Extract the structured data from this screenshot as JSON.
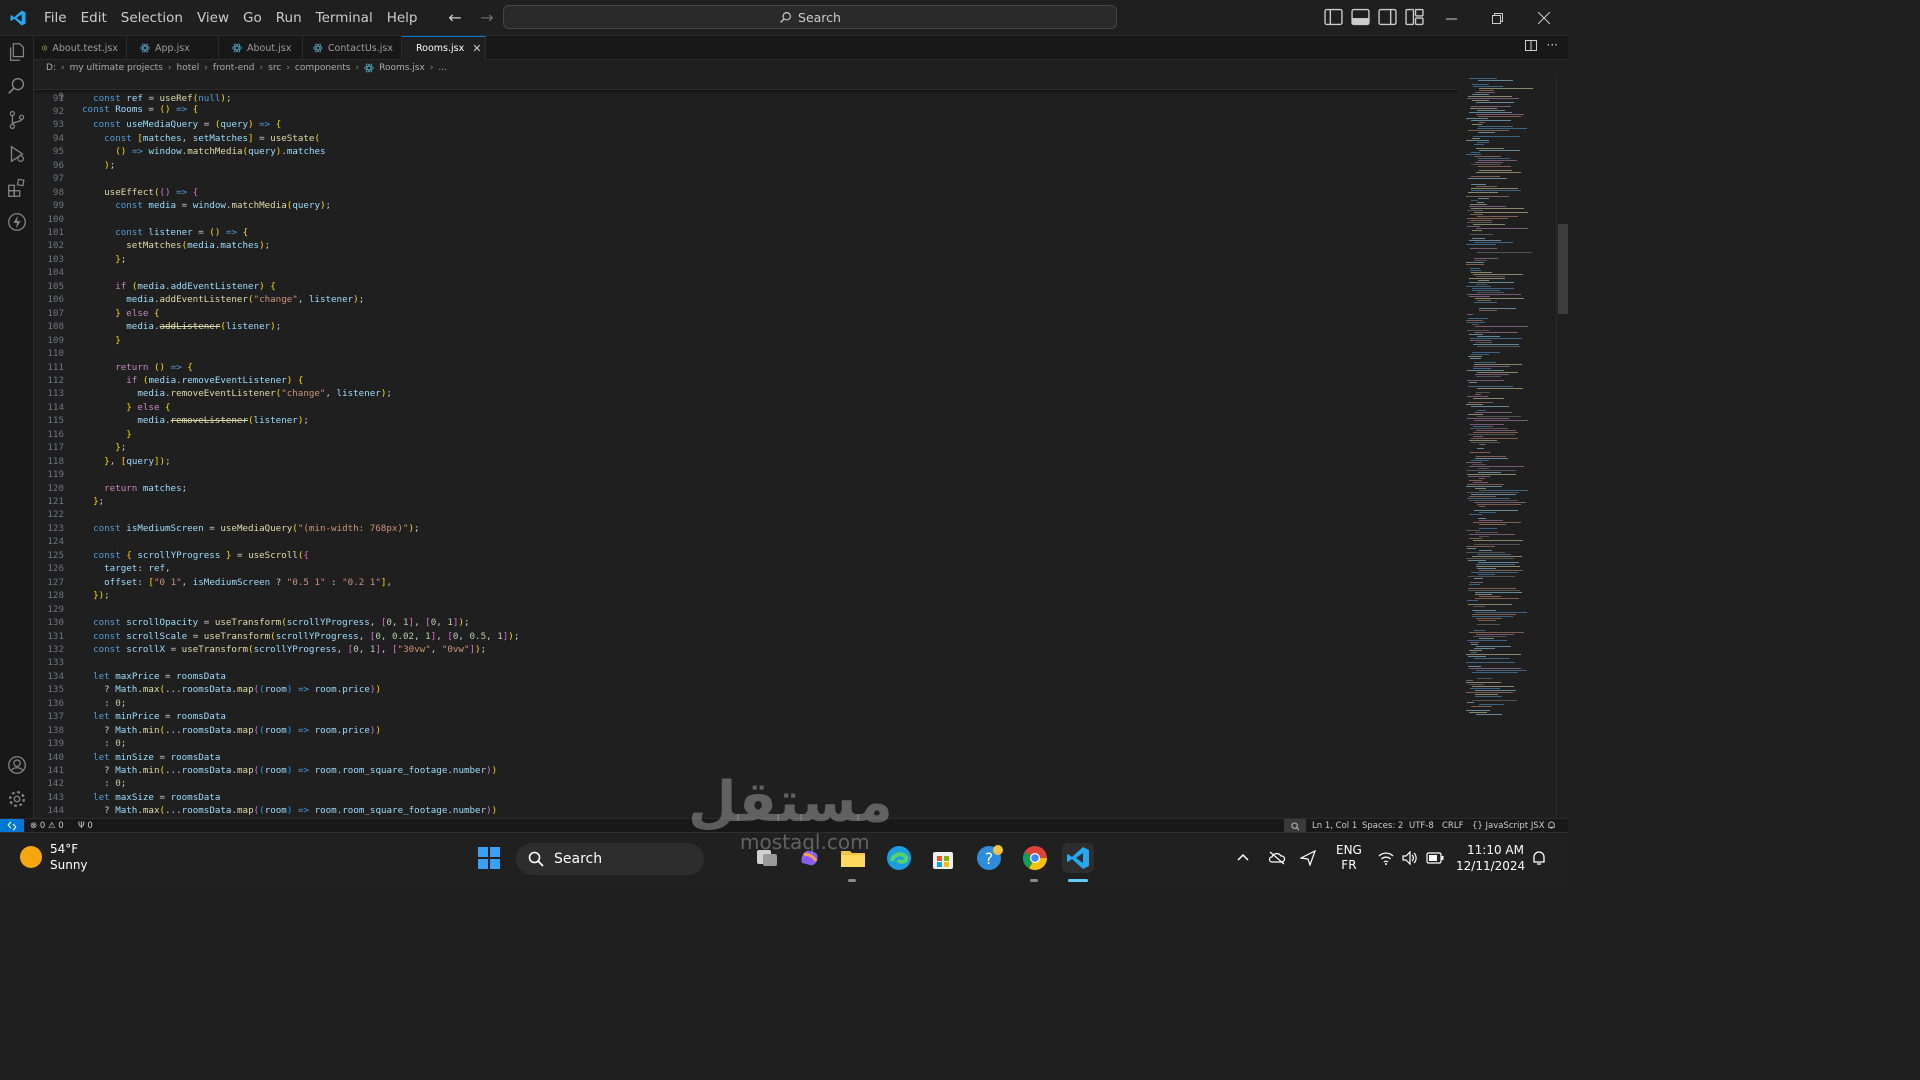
{
  "titlebar": {
    "menu": [
      "File",
      "Edit",
      "Selection",
      "View",
      "Go",
      "Run",
      "Terminal",
      "Help"
    ],
    "search_placeholder": "Search"
  },
  "tabs": [
    {
      "label": "About.test.jsx",
      "icon": "warning-react-icon",
      "active": false
    },
    {
      "label": "App.jsx",
      "icon": "react-icon",
      "active": false
    },
    {
      "label": "About.jsx",
      "icon": "react-icon",
      "active": false
    },
    {
      "label": "ContactUs.jsx",
      "icon": "react-icon",
      "active": false
    },
    {
      "label": "Rooms.jsx",
      "icon": "react-icon",
      "active": true
    }
  ],
  "breadcrumb": [
    "D:",
    "my ultimate projects",
    "hotel",
    "front-end",
    "src",
    "components",
    "Rooms.jsx",
    "..."
  ],
  "sticky_line": {
    "number": "9",
    "text": "const Rooms = () => {"
  },
  "code_lines": [
    {
      "n": "91",
      "t": "  const ref = useRef(null);"
    },
    {
      "n": "92",
      "t": ""
    },
    {
      "n": "93",
      "t": "  const useMediaQuery = (query) => {"
    },
    {
      "n": "94",
      "t": "    const [matches, setMatches] = useState("
    },
    {
      "n": "95",
      "t": "      () => window.matchMedia(query).matches"
    },
    {
      "n": "96",
      "t": "    );"
    },
    {
      "n": "97",
      "t": ""
    },
    {
      "n": "98",
      "t": "    useEffect(() => {"
    },
    {
      "n": "99",
      "t": "      const media = window.matchMedia(query);"
    },
    {
      "n": "100",
      "t": ""
    },
    {
      "n": "101",
      "t": "      const listener = () => {"
    },
    {
      "n": "102",
      "t": "        setMatches(media.matches);"
    },
    {
      "n": "103",
      "t": "      };"
    },
    {
      "n": "104",
      "t": ""
    },
    {
      "n": "105",
      "t": "      if (media.addEventListener) {"
    },
    {
      "n": "106",
      "t": "        media.addEventListener(\"change\", listener);"
    },
    {
      "n": "107",
      "t": "      } else {"
    },
    {
      "n": "108",
      "t": "        media.addListener(listener);"
    },
    {
      "n": "109",
      "t": "      }"
    },
    {
      "n": "110",
      "t": ""
    },
    {
      "n": "111",
      "t": "      return () => {"
    },
    {
      "n": "112",
      "t": "        if (media.removeEventListener) {"
    },
    {
      "n": "113",
      "t": "          media.removeEventListener(\"change\", listener);"
    },
    {
      "n": "114",
      "t": "        } else {"
    },
    {
      "n": "115",
      "t": "          media.removeListener(listener);"
    },
    {
      "n": "116",
      "t": "        }"
    },
    {
      "n": "117",
      "t": "      };"
    },
    {
      "n": "118",
      "t": "    }, [query]);"
    },
    {
      "n": "119",
      "t": ""
    },
    {
      "n": "120",
      "t": "    return matches;"
    },
    {
      "n": "121",
      "t": "  };"
    },
    {
      "n": "122",
      "t": ""
    },
    {
      "n": "123",
      "t": "  const isMediumScreen = useMediaQuery(\"(min-width: 768px)\");"
    },
    {
      "n": "124",
      "t": ""
    },
    {
      "n": "125",
      "t": "  const { scrollYProgress } = useScroll({"
    },
    {
      "n": "126",
      "t": "    target: ref,"
    },
    {
      "n": "127",
      "t": "    offset: [\"0 1\", isMediumScreen ? \"0.5 1\" : \"0.2 1\"],"
    },
    {
      "n": "128",
      "t": "  });"
    },
    {
      "n": "129",
      "t": ""
    },
    {
      "n": "130",
      "t": "  const scrollOpacity = useTransform(scrollYProgress, [0, 1], [0, 1]);"
    },
    {
      "n": "131",
      "t": "  const scrollScale = useTransform(scrollYProgress, [0, 0.02, 1], [0, 0.5, 1]);"
    },
    {
      "n": "132",
      "t": "  const scrollX = useTransform(scrollYProgress, [0, 1], [\"30vw\", \"0vw\"]);"
    },
    {
      "n": "133",
      "t": ""
    },
    {
      "n": "134",
      "t": "  let maxPrice = roomsData"
    },
    {
      "n": "135",
      "t": "    ? Math.max(...roomsData.map((room) => room.price))"
    },
    {
      "n": "136",
      "t": "    : 0;"
    },
    {
      "n": "137",
      "t": "  let minPrice = roomsData"
    },
    {
      "n": "138",
      "t": "    ? Math.min(...roomsData.map((room) => room.price))"
    },
    {
      "n": "139",
      "t": "    : 0;"
    },
    {
      "n": "140",
      "t": "  let minSize = roomsData"
    },
    {
      "n": "141",
      "t": "    ? Math.min(...roomsData.map((room) => room.room_square_footage.number))"
    },
    {
      "n": "142",
      "t": "    : 0;"
    },
    {
      "n": "143",
      "t": "  let maxSize = roomsData"
    },
    {
      "n": "144",
      "t": "    ? Math.max(...roomsData.map((room) => room.room_square_footage.number))"
    }
  ],
  "statusbar": {
    "problems": "0",
    "warnings": "0",
    "ports": "0",
    "position": "Ln 1, Col 1",
    "spaces": "Spaces: 2",
    "encoding": "UTF-8",
    "eol": "CRLF",
    "language": "JavaScript JSX"
  },
  "taskbar": {
    "temperature": "54°F",
    "condition": "Sunny",
    "search_label": "Search",
    "lang_top": "ENG",
    "lang_bottom": "FR",
    "time": "11:10 AM",
    "date": "12/11/2024"
  },
  "watermark": {
    "main": "مستقل",
    "sub": "mostaql.com"
  },
  "colors": {
    "accent": "#0078d4",
    "editor_bg": "#1f1f1f",
    "keyword": "#569cd6",
    "function": "#dcdcaa",
    "variable": "#9cdcfe",
    "string": "#ce9178",
    "number": "#b5cea8"
  }
}
